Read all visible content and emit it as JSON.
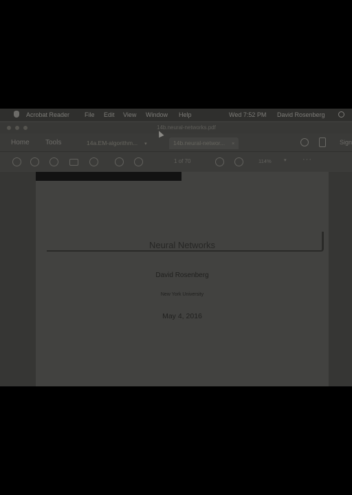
{
  "menubar": {
    "items": [
      "Acrobat Reader",
      "File",
      "Edit",
      "View",
      "Window",
      "Help"
    ],
    "clock": "Wed 7:52 PM",
    "user": "David Rosenberg"
  },
  "window": {
    "title": "14b.neural-networks.pdf"
  },
  "tabs": {
    "home": "Home",
    "tools": "Tools",
    "documents": [
      {
        "label": "14a.EM-algorithm..."
      },
      {
        "label": "14b.neural-networ..."
      }
    ],
    "sign": "Sign"
  },
  "toolbar": {
    "page": "1 of 70",
    "zoom": "114%",
    "more": "···"
  },
  "document": {
    "title": "Neural Networks",
    "author": "David Rosenberg",
    "institution": "New York University",
    "date": "May 4, 2016"
  }
}
